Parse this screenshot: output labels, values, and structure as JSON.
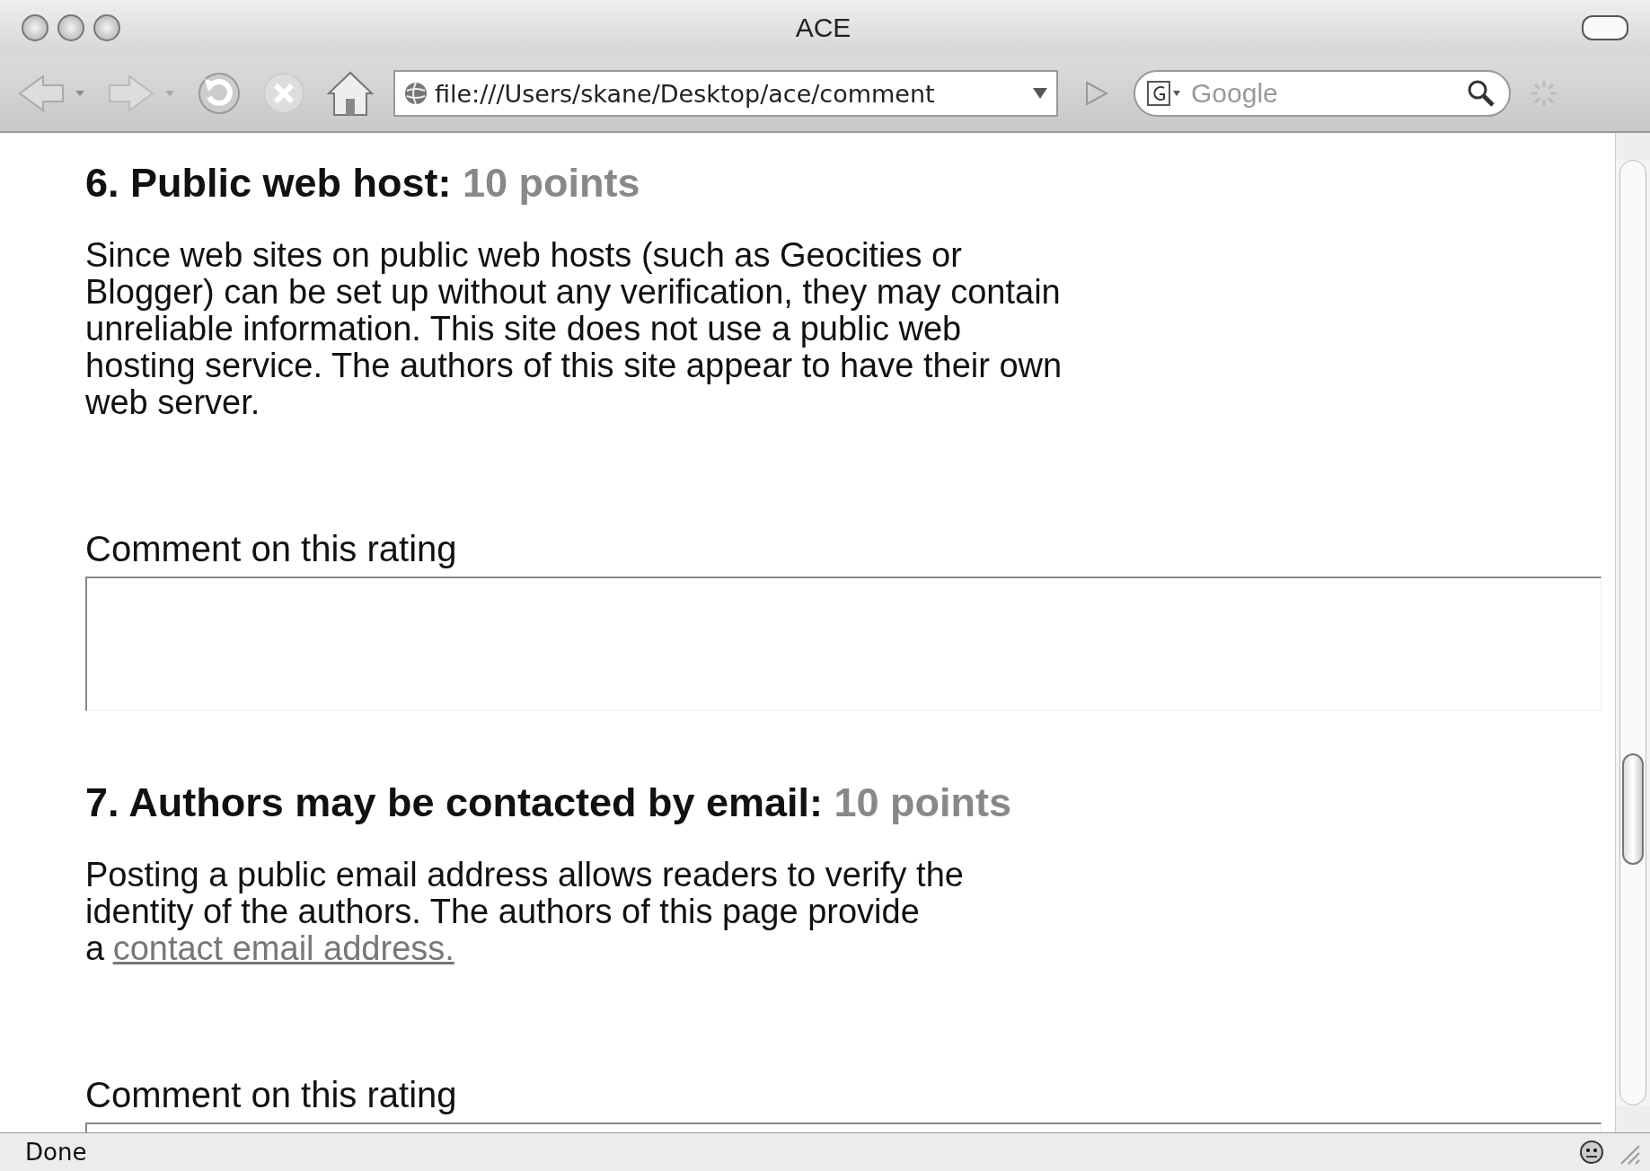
{
  "window": {
    "title": "ACE"
  },
  "toolbar": {
    "address": "file:///Users/skane/Desktop/ace/comment",
    "search": {
      "placeholder": "Google"
    }
  },
  "sections": [
    {
      "heading": "6. Public web host:",
      "points": "10 points",
      "text": "Since web sites on public web hosts (such as Geocities or Blogger) can be set up without any verification, they may contain unreliable information. This site does not use a public web hosting service. The authors of this site appear to have their own web server.",
      "comment_label": "Comment on this rating"
    },
    {
      "heading": "7. Authors may be contacted by email:",
      "points": "10 points",
      "text": "Posting a public email address allows readers to verify the identity of the authors. The authors of this page provide a",
      "link": "contact email address.",
      "comment_label": "Comment on this rating"
    }
  ],
  "status_bar": {
    "text": "Done"
  }
}
